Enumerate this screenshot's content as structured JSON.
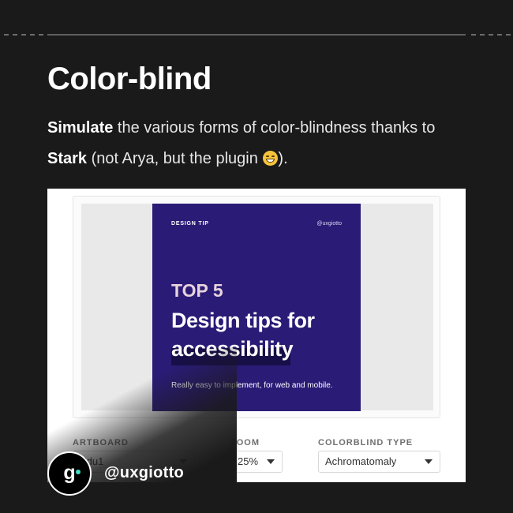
{
  "title": "Color-blind",
  "subtitle": {
    "simulate_bold": "Simulate",
    "text_1": " the various forms of color-blindness thanks to",
    "stark_bold": "Stark",
    "text_2": " (not Arya, but the plugin ",
    "text_3": ").",
    "emoji_icon": "grinning-sweat-emoji-icon"
  },
  "artwork": {
    "tag": "DESIGN TIP",
    "handle": "@uxgiotto",
    "top5": "TOP 5",
    "headline_1": "Design tips for",
    "headline_2": "accessibility",
    "description": "Really easy to implement, for web and mobile.",
    "background_color": "#2a1b76"
  },
  "controls": {
    "artboard_label": "ARTBOARD",
    "artboard_value": "Edu1",
    "zoom_label": "ZOOM",
    "zoom_value": "25%",
    "colorblind_label": "COLORBLIND TYPE",
    "colorblind_value": "Achromatomaly"
  },
  "brand": {
    "logo_letter": "g",
    "handle": "@uxgiotto",
    "accent_color": "#3fe0c5"
  }
}
